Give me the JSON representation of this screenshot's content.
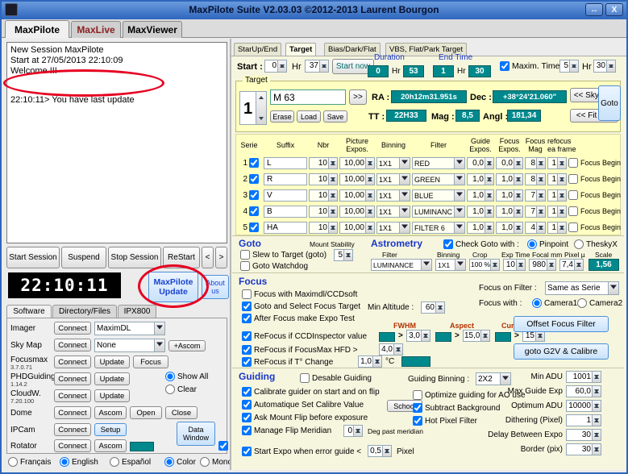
{
  "titlebar": {
    "title": "MaxPilote Suite  V2.03.03  ©2012-2013 Laurent Bourgon",
    "resize_icon": "↔",
    "close_icon": "X"
  },
  "main_tabs": [
    {
      "label": "MaxPilote"
    },
    {
      "label": "MaxLive"
    },
    {
      "label": "MaxViewer"
    }
  ],
  "log": {
    "line1": "New Session MaxPilote",
    "line2": "Start at 27/05/2013 22:10:09",
    "line3": "Welcome !!!",
    "highlight": "22:10:11> You have last update"
  },
  "session": {
    "start": "Start Session",
    "suspend": "Suspend",
    "stop": "Stop Session",
    "restart": "ReStart",
    "prev": "<",
    "next": ">"
  },
  "clock": "22:10:11",
  "update_button": {
    "line1": "MaxPilote",
    "line2": "Update"
  },
  "about_button": "About us",
  "left_tabs": [
    "Software",
    "Directory/Files",
    "IPX800"
  ],
  "software": {
    "imager": {
      "label": "Imager",
      "connect": "Connect",
      "value": "MaximDL"
    },
    "skymap": {
      "label": "Sky Map",
      "connect": "Connect",
      "value": "None",
      "ascom": "+Ascom"
    },
    "focusmax": {
      "label": "Focusmax",
      "version": "3.7.0.71",
      "connect": "Connect",
      "update": "Update",
      "focus": "Focus"
    },
    "phd": {
      "label": "PHDGuiding",
      "version": "1.14.2",
      "connect": "Connect",
      "update": "Update",
      "show_all": "Show All",
      "clear": "Clear"
    },
    "cloudw": {
      "label": "CloudW.",
      "version": "7.20.100",
      "connect": "Connect",
      "update": "Update"
    },
    "dome": {
      "label": "Dome",
      "connect": "Connect",
      "ascom": "Ascom",
      "open": "Open",
      "close": "Close"
    },
    "ipcam": {
      "label": "IPCam",
      "connect": "Connect",
      "setup": "Setup"
    },
    "rotator": {
      "label": "Rotator",
      "connect": "Connect",
      "ascom": "Ascom",
      "data_window": "Data Window"
    },
    "langs": [
      "Français",
      "English",
      "Español"
    ],
    "color": "Color",
    "mono": "Mono"
  },
  "right_tabs": [
    "StarUp/End",
    "Target",
    "Bias/Dark/Flat",
    "VBS, Flat/Park Target"
  ],
  "start_section": {
    "start_label": "Start :",
    "hr1": "0",
    "hr_label": "Hr",
    "min1": "37",
    "start_now": "Start now",
    "duration_label": "Duration",
    "dur_hr": "0",
    "dur_min": "53",
    "end_label": "End Time",
    "end_hr": "1",
    "end_min": "30",
    "maxim": "Maxim. Time",
    "max_hr": "5",
    "max_min": "30"
  },
  "target": {
    "legend": "Target",
    "index": "1",
    "name": "M 63",
    "expand": ">>",
    "ra_label": "RA :",
    "ra": "20h12m31.951s",
    "dec_label": "Dec :",
    "dec": "+38°24'21.060\"",
    "skymap": "<< SkyMap",
    "goto": "Goto",
    "erase": "Erase",
    "load": "Load",
    "save": "Save",
    "tt_label": "TT :",
    "tt": "22H33",
    "mag_label": "Mag :",
    "mag": "8,5",
    "angl_label": "Angl :",
    "angl": "181,34",
    "fitfile": "<< Fit File"
  },
  "table": {
    "headers": [
      "Serie",
      "Suffix",
      "Nbr",
      "Picture\nExpos.",
      "Binning",
      "Filter",
      "Guide\nExpos.",
      "Focus\nExpos.",
      "Focus\nMag",
      "refocus\nea frame"
    ],
    "focus_begin": "Focus Begin",
    "rows": [
      {
        "num": "1",
        "suffix": "L",
        "nbr": "10",
        "expos": "10,00",
        "bin": "1X1",
        "filter": "RED",
        "guide": "0,0",
        "focus": "0,0",
        "mag": "8",
        "refocus": "1"
      },
      {
        "num": "2",
        "suffix": "R",
        "nbr": "10",
        "expos": "10,00",
        "bin": "1X1",
        "filter": "GREEN",
        "guide": "1,0",
        "focus": "1,0",
        "mag": "8",
        "refocus": "1"
      },
      {
        "num": "3",
        "suffix": "V",
        "nbr": "10",
        "expos": "10,00",
        "bin": "1X1",
        "filter": "BLUE",
        "guide": "1,0",
        "focus": "1,0",
        "mag": "7",
        "refocus": "1"
      },
      {
        "num": "4",
        "suffix": "B",
        "nbr": "10",
        "expos": "10,00",
        "bin": "1X1",
        "filter": "LUMINANC",
        "guide": "1,0",
        "focus": "1,0",
        "mag": "7",
        "refocus": "1"
      },
      {
        "num": "5",
        "suffix": "HA",
        "nbr": "10",
        "expos": "10,00",
        "bin": "1X1",
        "filter": "FILTER 6",
        "guide": "1,0",
        "focus": "1,0",
        "mag": "4",
        "refocus": "1"
      }
    ]
  },
  "goto_section": {
    "title": "Goto",
    "stability_label": "Mount Stability",
    "slew": "Slew to Target  (goto)",
    "stability": "5",
    "watchdog": "Goto Watchdog"
  },
  "astrometry": {
    "title": "Astrometry",
    "check": "Check Goto with :",
    "pinpoint": "Pinpoint",
    "theskyx": "TheskyX",
    "filter_label": "Filter",
    "filter": "LUMINANCE",
    "bin_label": "Binning",
    "bin": "1X1",
    "crop_label": "Crop",
    "crop": "100 %",
    "exp_label": "Exp Time",
    "exp": "10",
    "focal_label": "Focal mm",
    "focal": "980",
    "pixel_label": "Pixel µ",
    "pixel": "7,4",
    "scale_label": "Scale",
    "scale": "1,56"
  },
  "focus_section": {
    "title": "Focus",
    "maximdl": "Focus with Maximdl/CCDsoft",
    "goto_select": "Goto and Select Focus Target",
    "min_alt_label": "Min Altitude :",
    "min_alt": "60",
    "expo_test": "After Focus make Expo Test",
    "ccd": "ReFocus if CCDInspector value",
    "fwhm_label": "FWHM",
    "gt": ">",
    "fwhm": "3,0",
    "aspect_label": "Aspect",
    "aspect": "15,0",
    "curv_label": "Curvature",
    "curv": "15",
    "hfd_label": "ReFocus if FocusMax HFD >",
    "hfd": "4,0",
    "temp_label": "ReFocus if  T°  Change",
    "temp": "1,0",
    "temp_unit": "°C",
    "on_filter_label": "Focus on Filter :",
    "on_filter": "Same as Serie",
    "with_label": "Focus with :",
    "camera1": "Camera1",
    "camera2": "Camera2",
    "offset_btn": "Offset Focus Filter",
    "g2v_btn": "goto G2V & Calibre"
  },
  "guiding": {
    "title": "Guiding",
    "desable": "Desable Guiding",
    "calibrate": "Calibrate guider on start and on flip",
    "auto_set": "Automatique Set Calibre Value",
    "school": "School",
    "ask_flip": "Ask Mount Flip before exposure",
    "manage_flip": "Manage Flip Meridian",
    "flip_val": "0",
    "deg_past": "Deg past meridian",
    "start_expo": "Start Expo when error guide <",
    "err": "0,5",
    "pixel": "Pixel",
    "bin_label": "Guiding Binning :",
    "bin": "2X2",
    "optimize": "Optimize guiding for  AO use",
    "subtract": "Subtract Background",
    "hot": "Hot Pixel Filter",
    "min_adu_label": "Min ADU",
    "min_adu": "1001",
    "max_exp_label": "Max Guide Exp",
    "max_exp": "60,0",
    "opt_adu_label": "Optimum ADU",
    "opt_adu": "10000",
    "dith_label": "Dithering (Pixel)",
    "dith": "1",
    "delay_label": "Delay Between Expo",
    "delay": "30",
    "border_label": "Border (pix)",
    "border": "30"
  }
}
